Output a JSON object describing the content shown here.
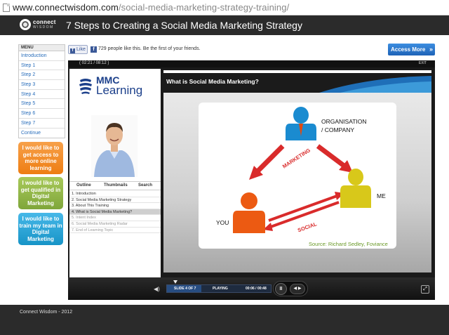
{
  "browser": {
    "url_domain": "www.connectwisdom.com",
    "url_path": "/social-media-marketing-strategy-training/"
  },
  "header": {
    "logo_line1": "connect",
    "logo_line2": "WISDOM",
    "title": "7 Steps to Creating a Social Media Marketing Strategy"
  },
  "sidebar": {
    "menu_heading": "MENU",
    "items": [
      {
        "label": "Introduction"
      },
      {
        "label": "Step 1"
      },
      {
        "label": "Step 2"
      },
      {
        "label": "Step 3"
      },
      {
        "label": "Step 4"
      },
      {
        "label": "Step 5"
      },
      {
        "label": "Step 6"
      },
      {
        "label": "Step 7"
      },
      {
        "label": "Continue"
      }
    ],
    "promos": [
      {
        "label": "I would like to get access to more online learning",
        "color": "#ee7d12"
      },
      {
        "label": "I would like to get qualified in Digital Marketing",
        "color": "#7fa63a"
      },
      {
        "label": "I would like to train my team in Digital Marketing",
        "color": "#1794c7"
      }
    ]
  },
  "social": {
    "like_label": "Like",
    "like_text": "729 people like this. Be the first of your friends."
  },
  "cta": {
    "access_label": "Access More",
    "chevron": "»"
  },
  "player": {
    "time_display": "( 02:21 / 08:12 )",
    "exit_label": "EXIT",
    "logo_top": "MMC",
    "logo_bottom": "Learning",
    "tabs": [
      "Outline",
      "Thumbnails",
      "Search"
    ],
    "outline": [
      {
        "label": "1. Introduction",
        "state": "normal"
      },
      {
        "label": "2. Social Media Marketing Strategy",
        "state": "normal"
      },
      {
        "label": "3. About This Training",
        "state": "normal"
      },
      {
        "label": "4. What is Social Media Marketing?",
        "state": "active"
      },
      {
        "label": "5. Intent Index",
        "state": "dim"
      },
      {
        "label": "6. Social Media Marketing Radar",
        "state": "dim"
      },
      {
        "label": "7. End of Learning Topic",
        "state": "dim"
      }
    ],
    "slide": {
      "title": "What is Social Media Marketing?",
      "org_label_1": "ORGANISATION",
      "org_label_2": "/ COMPANY",
      "me_label": "ME",
      "you_label": "YOU",
      "marketing_label": "MARKETING",
      "social_label": "SOCIAL",
      "source": "Source: Richard Sedley, Foviance"
    },
    "controls": {
      "slide_of": "SLIDE 4 OF 7",
      "status": "PLAYING",
      "timecode": "00:06 / 00:48",
      "progress": 0.33,
      "pause_label": "II",
      "nav_label": "◀ ▶"
    }
  },
  "footer": {
    "text": "Connect Wisdom - 2012"
  },
  "colors": {
    "header_bg": "#2b2b2b",
    "link_blue": "#2a6ebb",
    "cta_blue": "#1e63b7",
    "arrow_red": "#d92b2b",
    "figure_blue": "#1a8bd0",
    "figure_yellow": "#d8c81a",
    "figure_orange": "#ec5a12",
    "source_green": "#6a9a28"
  }
}
